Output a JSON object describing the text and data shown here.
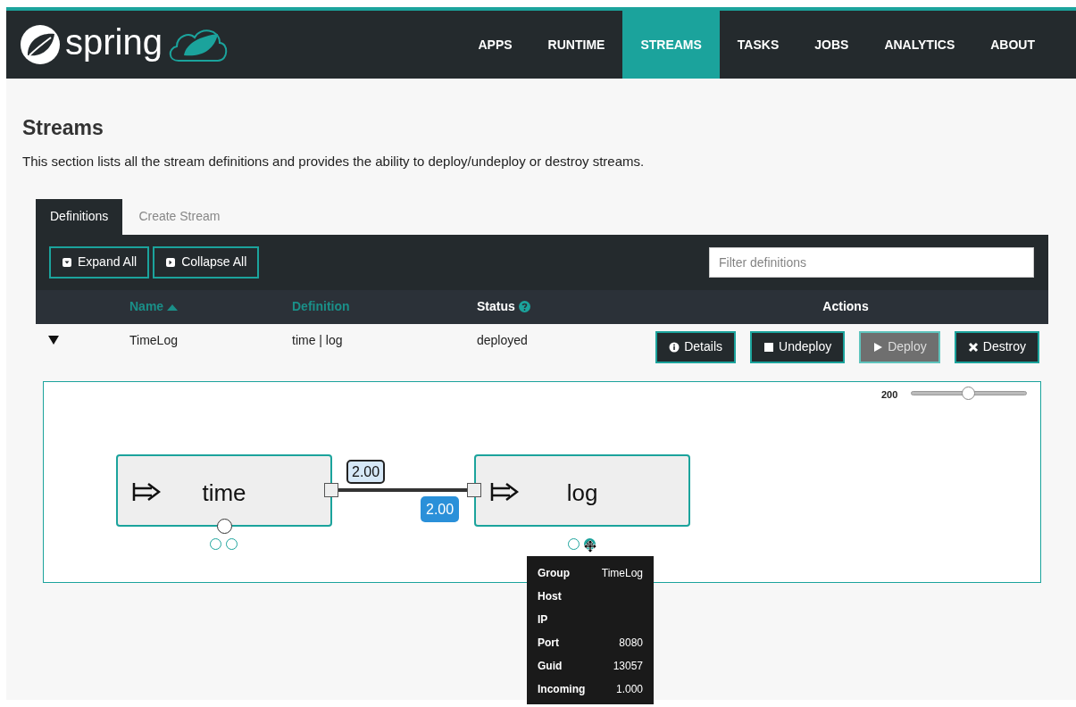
{
  "nav": {
    "brand": "spring",
    "items": [
      {
        "label": "APPS",
        "selected": false
      },
      {
        "label": "RUNTIME",
        "selected": false
      },
      {
        "label": "STREAMS",
        "selected": true
      },
      {
        "label": "TASKS",
        "selected": false
      },
      {
        "label": "JOBS",
        "selected": false
      },
      {
        "label": "ANALYTICS",
        "selected": false
      },
      {
        "label": "ABOUT",
        "selected": false
      }
    ]
  },
  "page": {
    "title": "Streams",
    "description": "This section lists all the stream definitions and provides the ability to deploy/undeploy or destroy streams."
  },
  "tabs": [
    {
      "label": "Definitions",
      "selected": true
    },
    {
      "label": "Create Stream",
      "selected": false
    }
  ],
  "toolbar": {
    "buttons": [
      {
        "label": "Expand All"
      },
      {
        "label": "Collapse All"
      }
    ],
    "filter": {
      "placeholder": "Filter definitions"
    }
  },
  "table": {
    "columns": [
      {
        "label": "Name",
        "kind": "sortable",
        "sorted": true
      },
      {
        "label": "Definition",
        "kind": "sortable",
        "sorted": false
      },
      {
        "label": "Status",
        "kind": "help",
        "sorted": false
      },
      {
        "label": "Actions",
        "kind": "plain",
        "sorted": false
      }
    ],
    "rows": [
      {
        "expanded": true,
        "name": "TimeLog",
        "definition": "time | log",
        "status": "deployed",
        "actions": [
          {
            "label": "Details",
            "disabled": false
          },
          {
            "label": "Undeploy",
            "disabled": false
          },
          {
            "label": "Deploy",
            "disabled": true
          },
          {
            "label": "Destroy",
            "disabled": false
          }
        ]
      }
    ]
  },
  "graph": {
    "zoom": {
      "reading": "200",
      "level": 0.49
    },
    "nodes": [
      {
        "label": "time",
        "kind": "source"
      },
      {
        "label": "log",
        "kind": "sink"
      }
    ],
    "link": {
      "labels": [
        "2.00",
        "2.00"
      ]
    },
    "tooltip": {
      "rows": [
        {
          "label": "Group",
          "value": "TimeLog"
        },
        {
          "label": "Host"
        },
        {
          "label": "IP"
        },
        {
          "label": "Port",
          "value": "8080"
        },
        {
          "label": "Guid",
          "value": "13057"
        },
        {
          "label": "Incoming",
          "value": "1.000"
        }
      ]
    }
  }
}
